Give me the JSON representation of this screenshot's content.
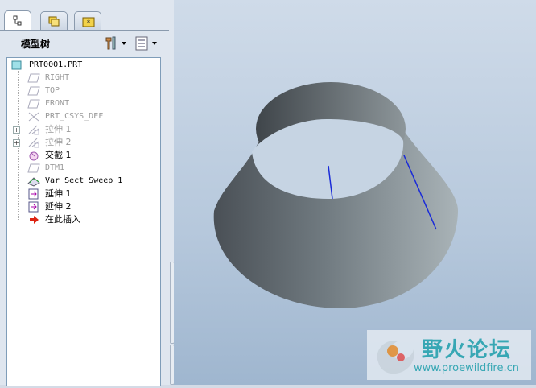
{
  "panel": {
    "title": "模型树",
    "tabs": [
      "model-tree",
      "layers",
      "favorites"
    ]
  },
  "tree": {
    "root": "PRT0001.PRT",
    "items": [
      {
        "label": "RIGHT",
        "icon": "datum-plane-icon",
        "dim": true,
        "expandable": false
      },
      {
        "label": "TOP",
        "icon": "datum-plane-icon",
        "dim": true,
        "expandable": false
      },
      {
        "label": "FRONT",
        "icon": "datum-plane-icon",
        "dim": true,
        "expandable": false
      },
      {
        "label": "PRT_CSYS_DEF",
        "icon": "coordinate-system-icon",
        "dim": true,
        "expandable": false
      },
      {
        "label": "拉伸 1",
        "icon": "extrude-icon",
        "dim": true,
        "expandable": true
      },
      {
        "label": "拉伸 2",
        "icon": "extrude-icon",
        "dim": true,
        "expandable": true
      },
      {
        "label": "交截 1",
        "icon": "intersect-icon",
        "dim": false,
        "expandable": false
      },
      {
        "label": "DTM1",
        "icon": "datum-plane-icon",
        "dim": true,
        "expandable": false
      },
      {
        "label": "Var Sect Sweep 1",
        "icon": "sweep-icon",
        "dim": false,
        "expandable": false
      },
      {
        "label": "延伸 1",
        "icon": "extend-icon",
        "dim": false,
        "expandable": false
      },
      {
        "label": "延伸 2",
        "icon": "extend-icon",
        "dim": false,
        "expandable": false
      },
      {
        "label": "在此插入",
        "icon": "insert-here-arrow-icon",
        "dim": false,
        "expandable": false
      }
    ]
  },
  "watermark": {
    "name": "野火论坛",
    "url": "www.proewildfire.cn"
  }
}
